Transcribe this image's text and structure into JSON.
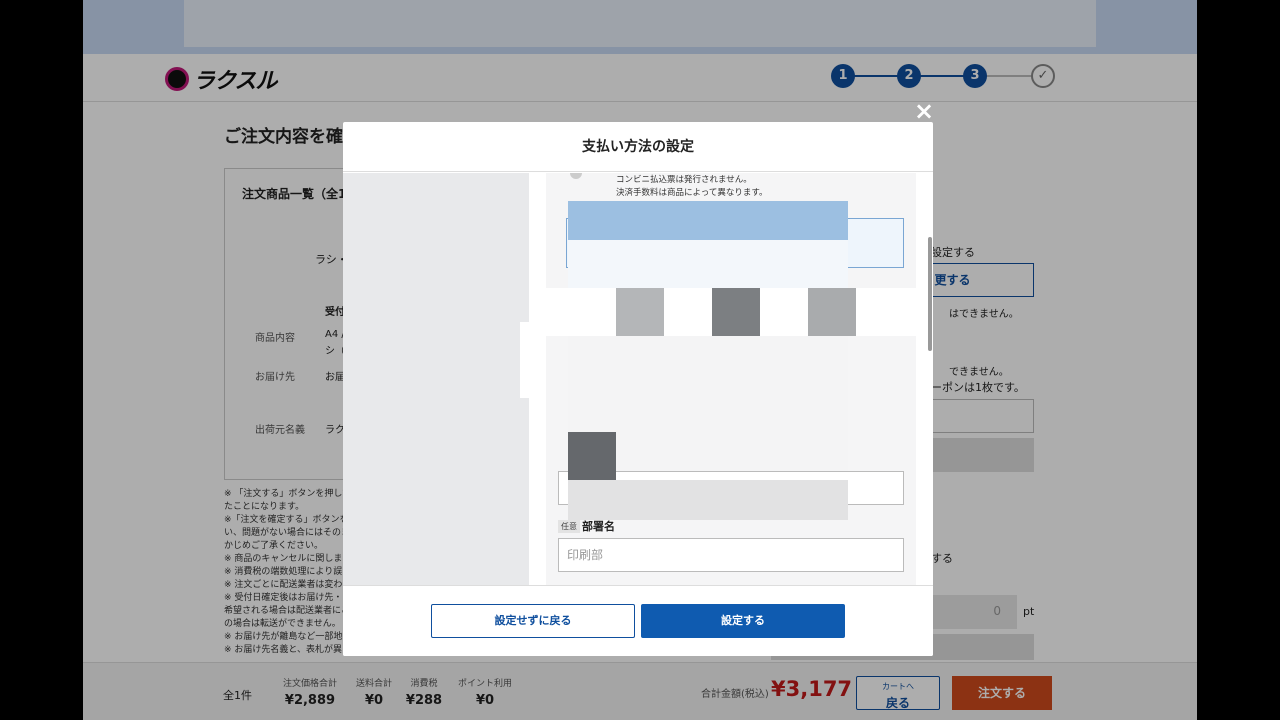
{
  "brand": {
    "logo_text": "ラクスル"
  },
  "steps": [
    "1",
    "2",
    "3",
    "✓"
  ],
  "page": {
    "title": "ご注文内容を確"
  },
  "order_box": {
    "heading": "注文商品一覧（全1",
    "product_name": "ラシ・",
    "reception_label": "受付",
    "rows": [
      {
        "label": "商品内容",
        "value": "A4 /",
        "value2": "シ（"
      },
      {
        "label": "お届け先",
        "value": "お届"
      },
      {
        "label": "出荷元名義",
        "value": "ラク"
      }
    ]
  },
  "notes": [
    "※ 「注文する」ボタンを押して",
    "たことになります。",
    "※「注文を確定する」ボタンを",
    "い、問題がない場合にはそのま",
    "かじめご了承ください。",
    "※ 商品のキャンセルに関しま",
    "※ 消費税の端数処理により誤",
    "※ 注文ごとに配送業者は変わ",
    "※ 受付日確定後はお届け先・",
    "希望される場合は配送業者にこ",
    "の場合は転送ができません。",
    "※ お届け先が離島など一部地",
    "※ お届け先名義と、表札が異"
  ],
  "right_panel": {
    "text_setting": "設定する",
    "change_button": "更する",
    "text_cannot1": "はできません。",
    "text_cannot2": "できません。",
    "coupon_text": "ーポンは1枚です。",
    "text_suru": "する",
    "points_value": "0",
    "points_unit": "pt"
  },
  "footer": {
    "count": "全1件",
    "items": [
      {
        "label": "注文価格合計",
        "value": "¥2,889"
      },
      {
        "label": "送料合計",
        "value": "¥0"
      },
      {
        "label": "消費税",
        "value": "¥288"
      },
      {
        "label": "ポイント利用",
        "value": "¥0"
      }
    ],
    "total_label": "合計金額(税込)",
    "total_value": "¥3,177",
    "back_small": "カートへ",
    "back_big": "戻る",
    "order_button": "注文する"
  },
  "modal": {
    "close": "×",
    "title": "支払い方法の設定",
    "note1": "コンビニ払込票は発行されません。",
    "note2": "決済手数料は商品によって異なります。",
    "field_tag": "任意",
    "field_label": "部署名",
    "field_placeholder": "印刷部",
    "cancel_button": "設定せずに戻る",
    "confirm_button": "設定する"
  },
  "colors": {
    "accent": "#0f4f9e",
    "primary_button": "#0f5bb0",
    "order_button": "#cf4a1c",
    "total": "#c11a1a"
  }
}
